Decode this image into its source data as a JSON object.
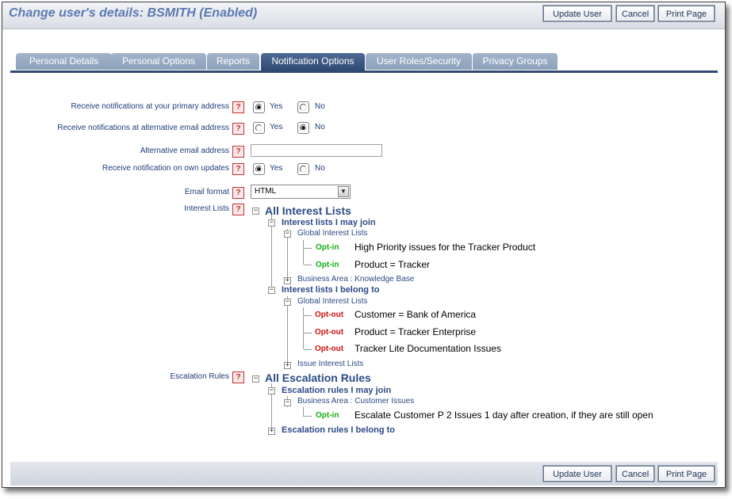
{
  "header": {
    "title": "Change user's details: BSMITH (Enabled)",
    "buttons": {
      "update": "Update User",
      "cancel": "Cancel",
      "print": "Print Page"
    }
  },
  "tabs": [
    {
      "label": "Personal Details",
      "active": false
    },
    {
      "label": "Personal Options",
      "active": false
    },
    {
      "label": "Reports",
      "active": false
    },
    {
      "label": "Notification Options",
      "active": true
    },
    {
      "label": "User Roles/Security",
      "active": false
    },
    {
      "label": "Privacy Groups",
      "active": false
    }
  ],
  "form": {
    "help_glyph": "?",
    "primary": {
      "label": "Receive notifications at your primary address",
      "yes": "Yes",
      "no": "No",
      "selected": "Yes"
    },
    "alternative": {
      "label": "Receive notifications at alternative email address",
      "yes": "Yes",
      "no": "No",
      "selected": "No"
    },
    "alt_email": {
      "label": "Alternative email address",
      "value": ""
    },
    "own_updates": {
      "label": "Receive notification on own updates",
      "yes": "Yes",
      "no": "No",
      "selected": "Yes"
    },
    "email_format": {
      "label": "Email format",
      "value": "HTML"
    },
    "interest_label": "Interest Lists",
    "escalation_label": "Escalation Rules"
  },
  "interest_tree": {
    "root": "All Interest Lists",
    "may_join": {
      "label": "Interest lists I may join",
      "global": {
        "label": "Global Interest Lists",
        "items": [
          {
            "tag": "Opt-in",
            "text": "High Priority issues for the Tracker Product"
          },
          {
            "tag": "Opt-in",
            "text": "Product = Tracker"
          }
        ]
      },
      "business_area": "Business Area : Knowledge Base"
    },
    "belong_to": {
      "label": "Interest lists I belong to",
      "global": {
        "label": "Global Interest Lists",
        "items": [
          {
            "tag": "Opt-out",
            "text": "Customer = Bank of America"
          },
          {
            "tag": "Opt-out",
            "text": "Product = Tracker Enterprise"
          },
          {
            "tag": "Opt-out",
            "text": "Tracker Lite Documentation Issues"
          }
        ]
      },
      "issue_lists": "Issue Interest Lists"
    }
  },
  "escalation_tree": {
    "root": "All Escalation Rules",
    "may_join": {
      "label": "Escalation rules I may join",
      "business_area": {
        "label": "Business Area : Customer Issues",
        "items": [
          {
            "tag": "Opt-in",
            "text": "Escalate Customer P 2 Issues 1 day after creation, if they are still open"
          }
        ]
      }
    },
    "belong_to": {
      "label": "Escalation rules I belong to"
    }
  },
  "tree_glyphs": {
    "expanded": "−",
    "collapsed": "+"
  },
  "footer": {
    "buttons": {
      "update": "Update User",
      "cancel": "Cancel",
      "print": "Print Page"
    }
  },
  "colors": {
    "accent": "#2f4a72",
    "tab_inactive": "#98abc3",
    "opt_in": "#16b016",
    "opt_out": "#cc1212",
    "help_red": "#c83030"
  }
}
